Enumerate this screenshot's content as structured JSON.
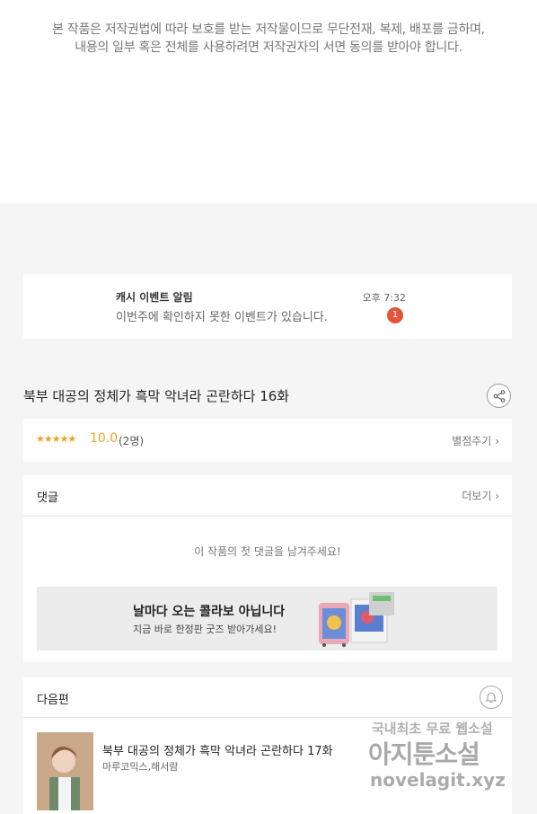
{
  "notice": {
    "line1": "본 작품은 저작권법에 따라 보호를 받는 저작물이므로 무단전재, 복제,  배포를 금하며,",
    "line2": "내용의 일부 혹은 전체를 사용하려면 저작권자의 서면 동의를 받아야 합니다."
  },
  "push": {
    "title": "캐시 이벤트 알림",
    "message": "이번주에 확인하지 못한 이벤트가 있습니다.",
    "time": "오후 7:32",
    "badge": "1",
    "badge_color": "#e2553b"
  },
  "episode": {
    "title": "북부 대공의 정체가 흑막 악녀라 곤란하다 16화",
    "share_icon": "share-icon"
  },
  "rating": {
    "stars": "★★★★★",
    "score": "10.0",
    "count": "(2명)",
    "give_label": "별점주기",
    "star_color": "#f0a020"
  },
  "comments": {
    "label": "댓글",
    "more_label": "더보기",
    "empty_text": "이 작품의 첫 댓글을 남겨주세요!"
  },
  "banner": {
    "headline": "날마다 오는 콜라보 아닙니다",
    "subline": "지금 바로 한정판 굿즈 받아가세요!"
  },
  "next": {
    "label": "다음편",
    "bell_icon": "bell-icon",
    "title": "북부 대공의 정체가 흑막 악녀라 곤란하다 17화",
    "author": "마루코믹스,해서람"
  },
  "watermark": {
    "line1": "국내최초 무료 웹소설",
    "line2": "아지툰소설",
    "line3": "novelagit.xyz"
  }
}
